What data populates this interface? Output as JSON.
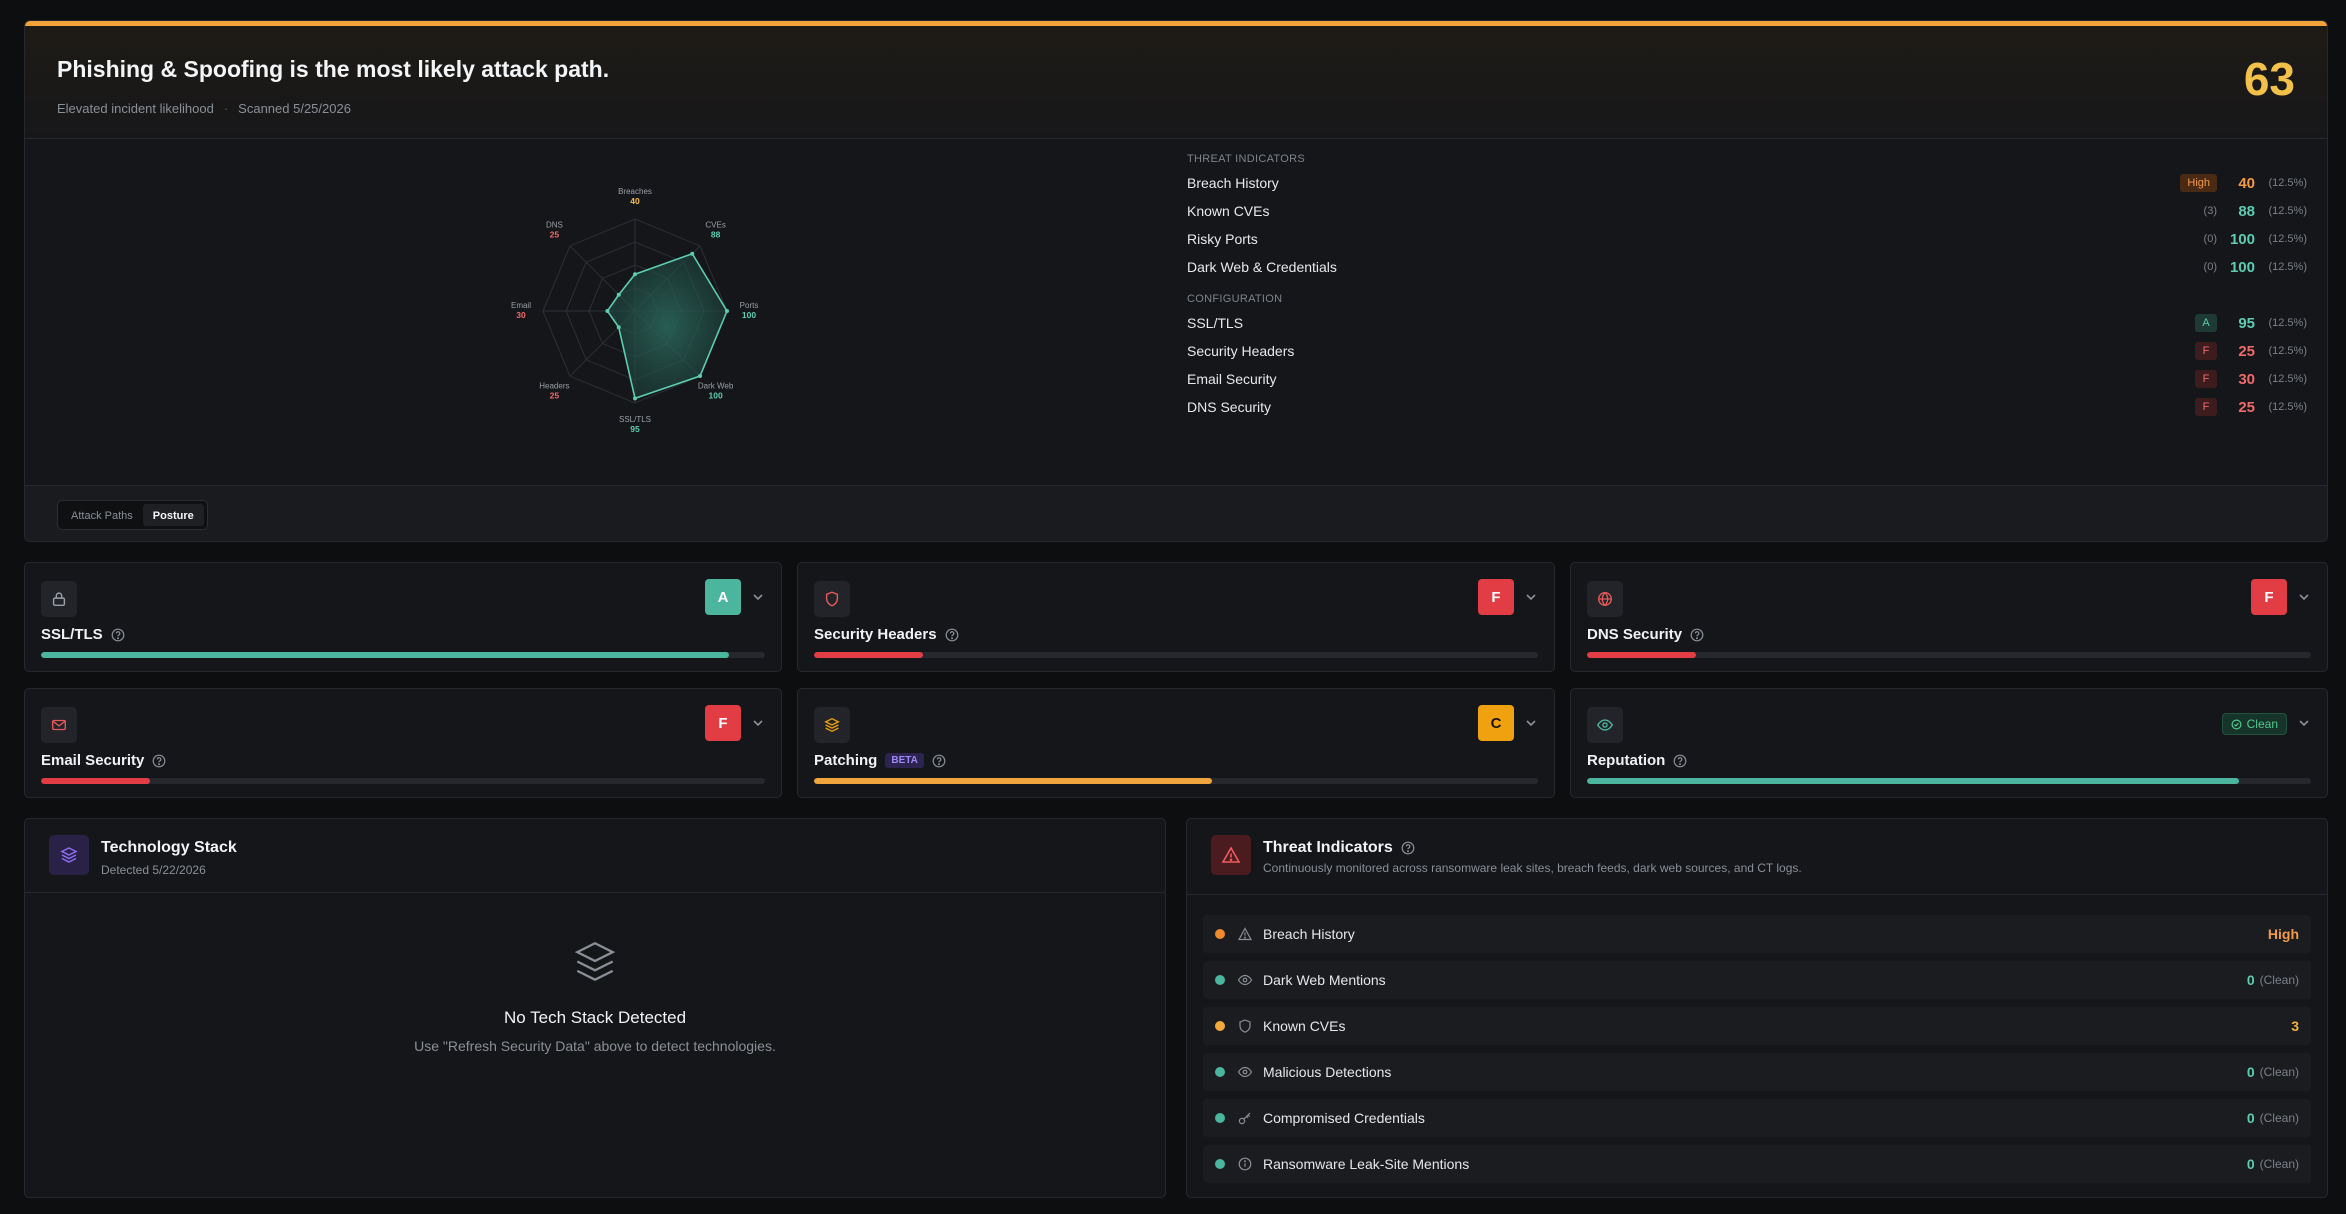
{
  "hero": {
    "title": "Phishing & Spoofing is the most likely attack path.",
    "likelihood": "Elevated incident likelihood",
    "separator": "·",
    "scanned": "Scanned 5/25/2026",
    "score": "63",
    "accent_color": "#f3a33a"
  },
  "radar": {
    "axes": [
      {
        "label": "Breaches",
        "value": 40
      },
      {
        "label": "CVEs",
        "value": 88
      },
      {
        "label": "Ports",
        "value": 100
      },
      {
        "label": "Dark Web",
        "value": 100
      },
      {
        "label": "SSL/TLS",
        "value": 95
      },
      {
        "label": "Headers",
        "value": 25
      },
      {
        "label": "Email",
        "value": 30
      },
      {
        "label": "DNS",
        "value": 25
      }
    ],
    "good_color": "#5ccdb2",
    "bad_color": "#ef6b6b",
    "warn_color": "#f3c14a"
  },
  "indicators": {
    "threat_heading": "THREAT INDICATORS",
    "threat_rows": [
      {
        "name": "Breach History",
        "badge": "High",
        "score": "40",
        "weight": "(12.5%)"
      },
      {
        "name": "Known CVEs",
        "count": "(3)",
        "score": "88",
        "weight": "(12.5%)"
      },
      {
        "name": "Risky Ports",
        "count": "(0)",
        "score": "100",
        "weight": "(12.5%)"
      },
      {
        "name": "Dark Web & Credentials",
        "count": "(0)",
        "score": "100",
        "weight": "(12.5%)"
      }
    ],
    "config_heading": "CONFIGURATION",
    "config_rows": [
      {
        "name": "SSL/TLS",
        "badge": "A",
        "score": "95",
        "weight": "(12.5%)"
      },
      {
        "name": "Security Headers",
        "badge": "F",
        "score": "25",
        "weight": "(12.5%)"
      },
      {
        "name": "Email Security",
        "badge": "F",
        "score": "30",
        "weight": "(12.5%)"
      },
      {
        "name": "DNS Security",
        "badge": "F",
        "score": "25",
        "weight": "(12.5%)"
      }
    ]
  },
  "view_toggle": {
    "options": [
      "Attack Paths",
      "Posture"
    ],
    "selected": "Posture"
  },
  "posture_cards": [
    {
      "label": "SSL/TLS",
      "grade": "A",
      "progress": 0.95,
      "icon": "lock-icon"
    },
    {
      "label": "Security Headers",
      "grade": "F",
      "progress": 0.15,
      "icon": "shield-icon"
    },
    {
      "label": "DNS Security",
      "grade": "F",
      "progress": 0.15,
      "icon": "globe-icon"
    },
    {
      "label": "Email Security",
      "grade": "F",
      "progress": 0.15,
      "icon": "mail-icon"
    },
    {
      "label": "Patching",
      "beta": "BETA",
      "grade": "C",
      "progress": 0.55,
      "icon": "layers-icon"
    },
    {
      "label": "Reputation",
      "status": "Clean",
      "progress": 0.9,
      "icon": "eye-icon"
    }
  ],
  "tech_stack": {
    "title": "Technology Stack",
    "detected": "Detected 5/22/2026",
    "empty_title": "No Tech Stack Detected",
    "empty_sub": "Use \"Refresh Security Data\" above to detect technologies.",
    "icon_color": "#8b6cf0"
  },
  "threat_panel": {
    "title": "Threat Indicators",
    "subtitle": "Continuously monitored across ransomware leak sites, breach feeds, dark web sources, and CT logs.",
    "rows": [
      {
        "name": "Breach History",
        "value": "High",
        "icon": "alert-triangle-icon",
        "status": "orange"
      },
      {
        "name": "Dark Web Mentions",
        "value": "0",
        "note": "(Clean)",
        "icon": "eye-icon",
        "status": "teal"
      },
      {
        "name": "Known CVEs",
        "value": "3",
        "icon": "shield-icon",
        "status": "amber"
      },
      {
        "name": "Malicious Detections",
        "value": "0",
        "note": "(Clean)",
        "icon": "eye-icon",
        "status": "teal"
      },
      {
        "name": "Compromised Credentials",
        "value": "0",
        "note": "(Clean)",
        "icon": "key-icon",
        "status": "teal"
      },
      {
        "name": "Ransomware Leak-Site Mentions",
        "value": "0",
        "note": "(Clean)",
        "icon": "info-circle-icon",
        "status": "teal"
      }
    ]
  }
}
